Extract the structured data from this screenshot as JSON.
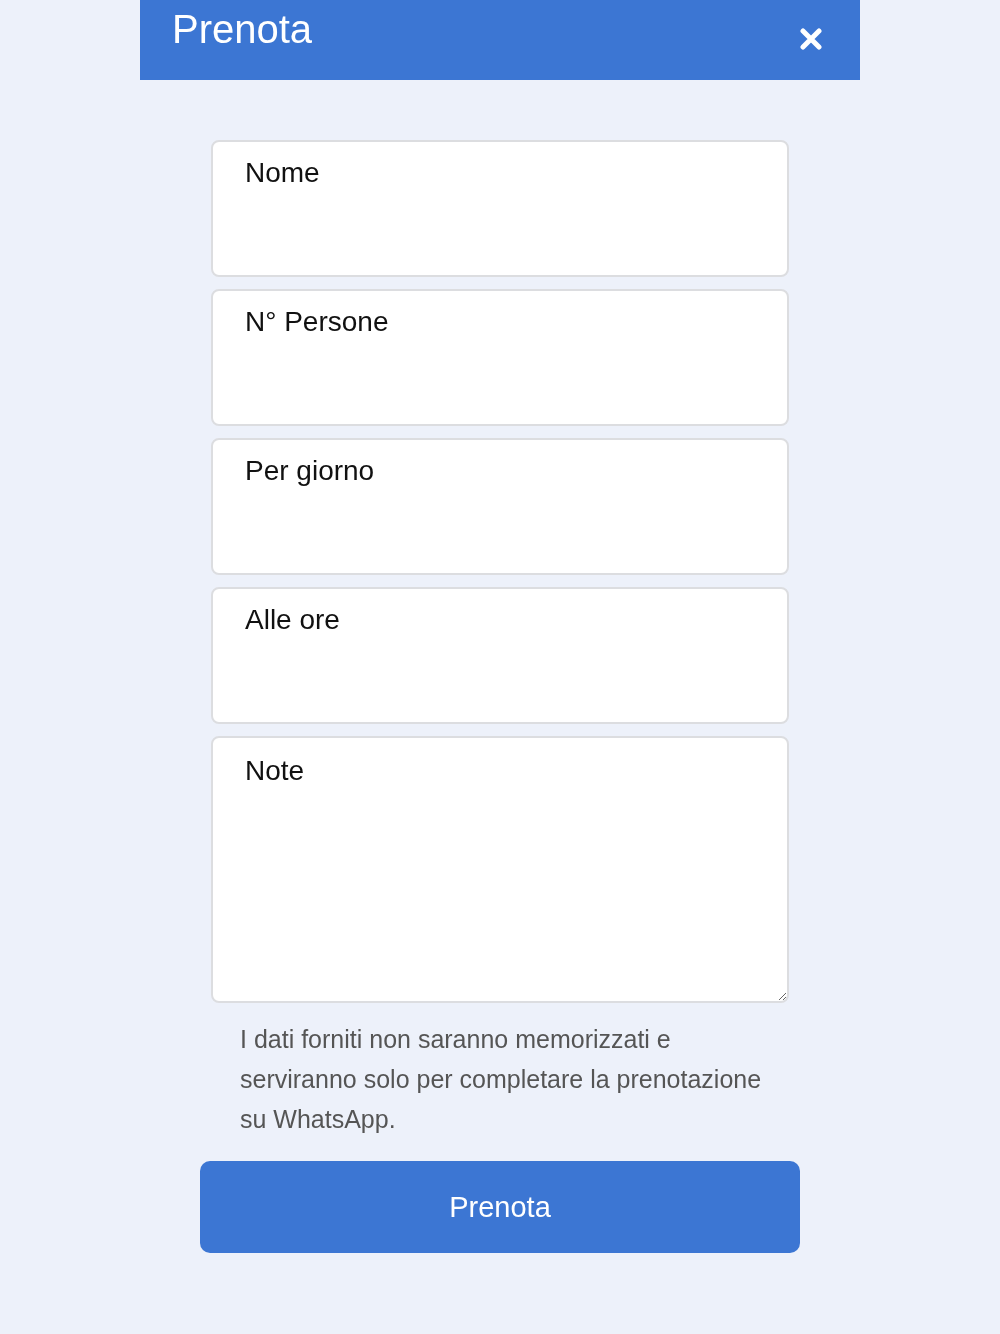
{
  "header": {
    "title": "Prenota"
  },
  "form": {
    "fields": [
      {
        "kind": "input",
        "placeholder": "Nome"
      },
      {
        "kind": "input",
        "placeholder": "N° Persone"
      },
      {
        "kind": "input",
        "placeholder": "Per giorno"
      },
      {
        "kind": "input",
        "placeholder": "Alle ore"
      },
      {
        "kind": "textarea",
        "placeholder": "Note"
      }
    ],
    "privacy_note": "I dati forniti non saranno memorizzati e serviranno solo per completare la prenotazione su WhatsApp.",
    "submit_button": "Prenota"
  }
}
